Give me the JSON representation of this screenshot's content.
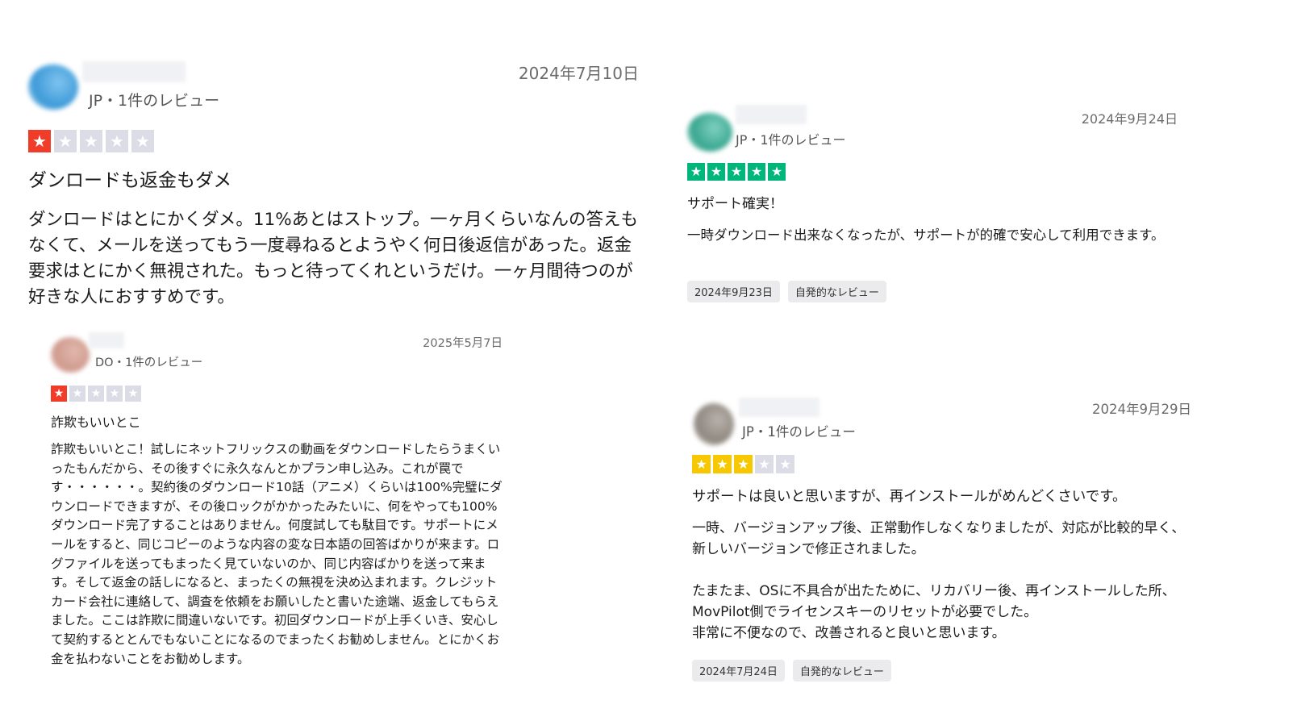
{
  "colors": {
    "star_red": "#f03c28",
    "star_green": "#00b67a",
    "star_yellow": "#f7c800",
    "star_empty": "#dcdce6"
  },
  "reviews": [
    {
      "meta": "JP・1件のレビュー",
      "date": "2024年7月10日",
      "rating": 1,
      "star_color": "#f03c28",
      "title": "ダンロードも返金もダメ",
      "body": [
        "ダンロードはとにかくダメ。11%あとはストップ。一ヶ月くらいなんの答えもなくて、メールを送ってもう一度尋ねるとようやく何日後返信があった。返金要求はとにかく無視された。もっと待ってくれというだけ。一ヶ月間待つのが好きな人におすすめです。"
      ],
      "tags": []
    },
    {
      "meta": "JP・1件のレビュー",
      "date": "2024年9月24日",
      "rating": 5,
      "star_color": "#00b67a",
      "title": "サポート確実！",
      "body": [
        "一時ダウンロード出来なくなったが、サポートが的確で安心して利用できます。"
      ],
      "tags": [
        "2024年9月23日",
        "自発的なレビュー"
      ]
    },
    {
      "meta": "DO・1件のレビュー",
      "date": "2025年5月7日",
      "rating": 1,
      "star_color": "#f03c28",
      "title": "詐欺もいいとこ",
      "body": [
        "詐欺もいいとこ！試しにネットフリックスの動画をダウンロードしたらうまくいったもんだから、その後すぐに永久なんとかプラン申し込み。これが罠です・・・・・・。契約後のダウンロード10話（アニメ）くらいは100%完璧にダウンロードできますが、その後ロックがかかったみたいに、何をやっても100%ダウンロード完了することはありません。何度試しても駄目です。サポートにメールをすると、同じコピーのような内容の変な日本語の回答ばかりが来ます。ログファイルを送ってもまったく見ていないのか、同じ内容ばかりを送って来ます。そして返金の話しになると、まったくの無視を決め込まれます。クレジットカード会社に連絡して、調査を依頼をお願いしたと書いた途端、返金してもらえました。ここは詐欺に間違いないです。初回ダウンロードが上手くいき、安心して契約するととんでもないことになるのでまったくお勧めしません。とにかくお金を払わないことをお勧めします。"
      ],
      "tags": []
    },
    {
      "meta": "JP・1件のレビュー",
      "date": "2024年9月29日",
      "rating": 3,
      "star_color": "#f7c800",
      "title": "サポートは良いと思いますが、再インストールがめんどくさいです。",
      "body": [
        "一時、バージョンアップ後、正常動作しなくなりましたが、対応が比較的早く、新しいバージョンで修正されました。",
        "たまたま、OSに不具合が出たために、リカバリー後、再インストールした所、MovPilot側でライセンスキーのリセットが必要でした。\n非常に不便なので、改善されると良いと思います。"
      ],
      "tags": [
        "2024年7月24日",
        "自発的なレビュー"
      ]
    }
  ]
}
